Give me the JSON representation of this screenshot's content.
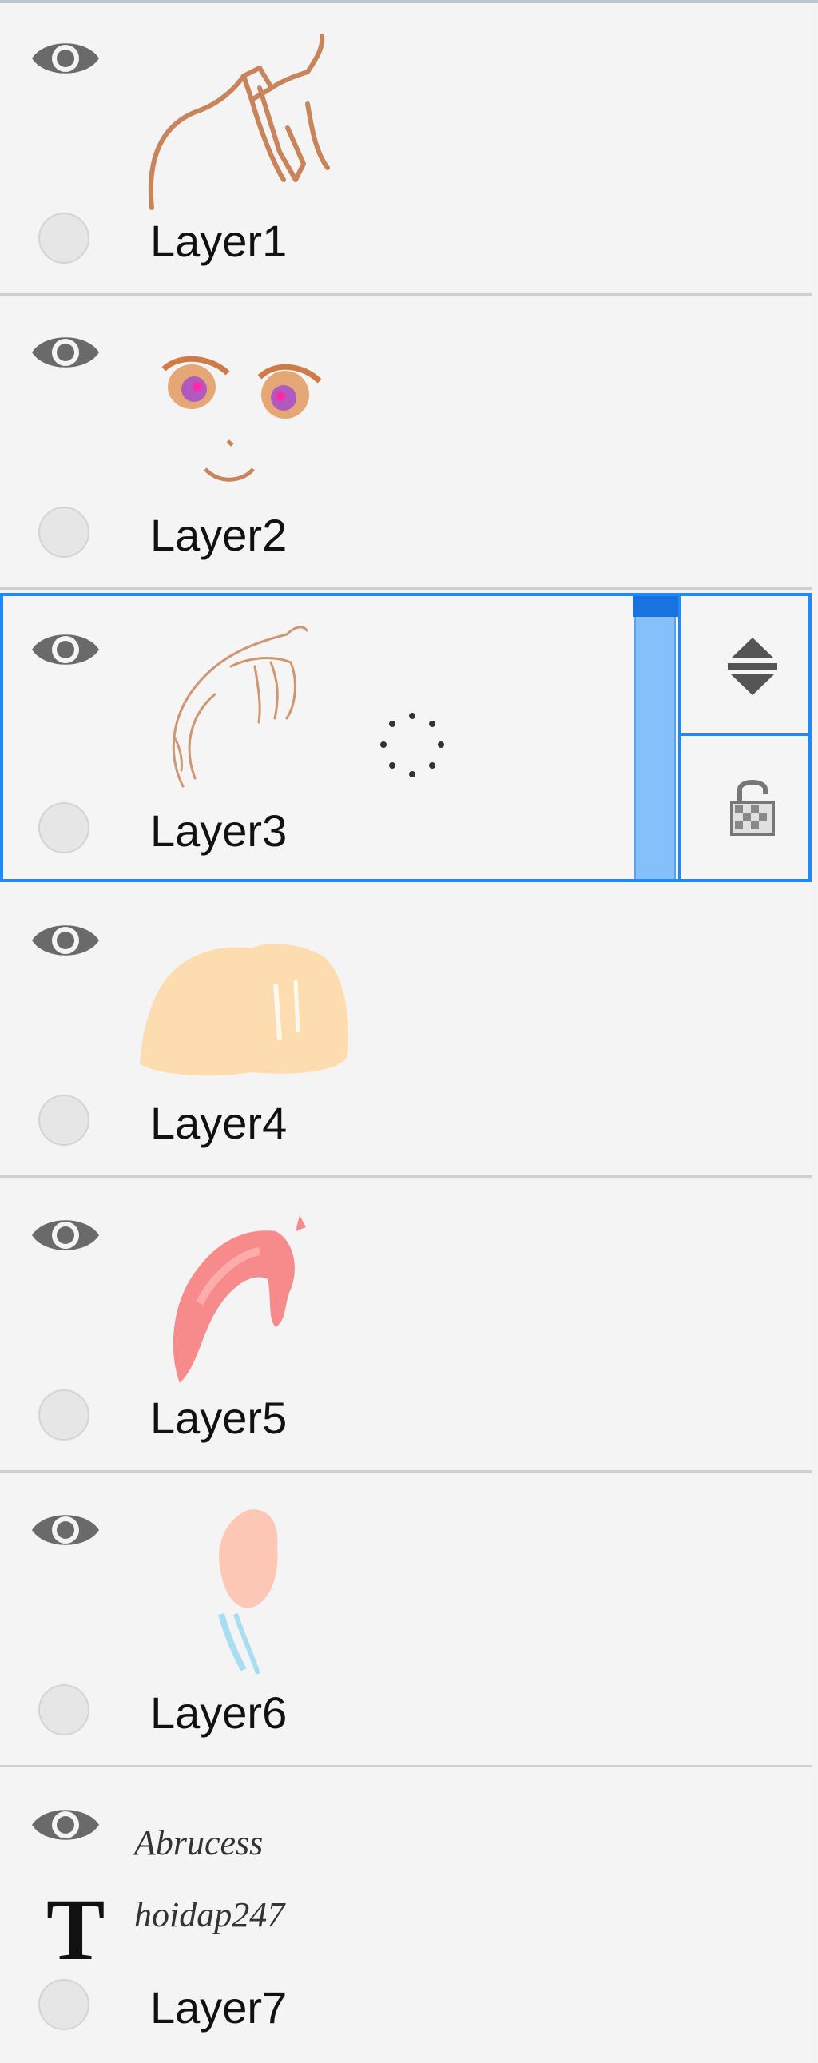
{
  "layers": [
    {
      "name": "Layer1",
      "thumbnail": "collar-sketch",
      "type": "image"
    },
    {
      "name": "Layer2",
      "thumbnail": "face-eyes-sketch",
      "type": "image"
    },
    {
      "name": "Layer3",
      "thumbnail": "hair-line-sketch",
      "type": "image",
      "selected": true
    },
    {
      "name": "Layer4",
      "thumbnail": "skin-fill-shape",
      "type": "image"
    },
    {
      "name": "Layer5",
      "thumbnail": "pink-hair-shape",
      "type": "image"
    },
    {
      "name": "Layer6",
      "thumbnail": "peach-blue-shape",
      "type": "image"
    },
    {
      "name": "Layer7",
      "type": "text",
      "text_lines": [
        "Abrucess",
        "hoidap247"
      ],
      "type_glyph": "T"
    }
  ],
  "colors": {
    "selection": "#1e88ff",
    "opacity_bar": "#86c0fb",
    "sketch_brown": "#c8845a",
    "skin": "#fddcb0",
    "pink": "#f78a8a"
  }
}
